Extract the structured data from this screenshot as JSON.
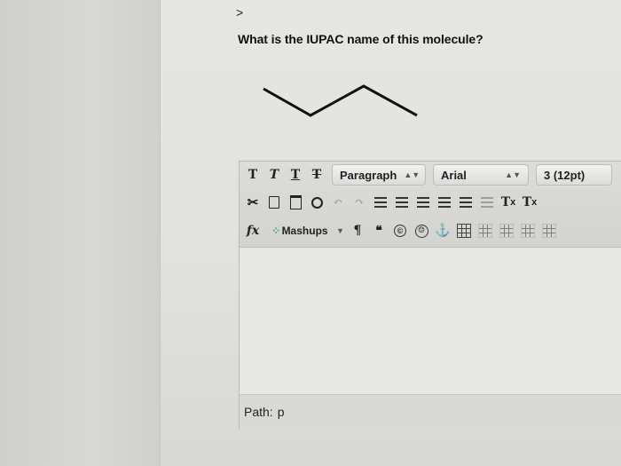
{
  "header": {
    "chevron": ">",
    "question": "What is the IUPAC name of this molecule?"
  },
  "toolbar": {
    "row1": {
      "format_buttons": [
        "T",
        "T",
        "T",
        "T"
      ],
      "paragraph_select": "Paragraph",
      "font_select": "Arial",
      "size_select": "3 (12pt)"
    },
    "row2": {
      "superscript": "T",
      "subscript": "T"
    },
    "row3": {
      "fx": "fx",
      "mashups": "Mashups",
      "pilcrow": "¶",
      "quote": "❝",
      "copyright": "©",
      "anchor": "⚓"
    }
  },
  "path": {
    "label": "Path:",
    "value": "p"
  },
  "icons": {
    "cut": "scissors-icon",
    "copy": "copy-icon",
    "paste": "paste-icon",
    "find": "search-icon",
    "undo": "undo-icon",
    "redo": "redo-icon"
  },
  "molecule": {
    "type": "skeletal-formula",
    "bonds": 3
  }
}
